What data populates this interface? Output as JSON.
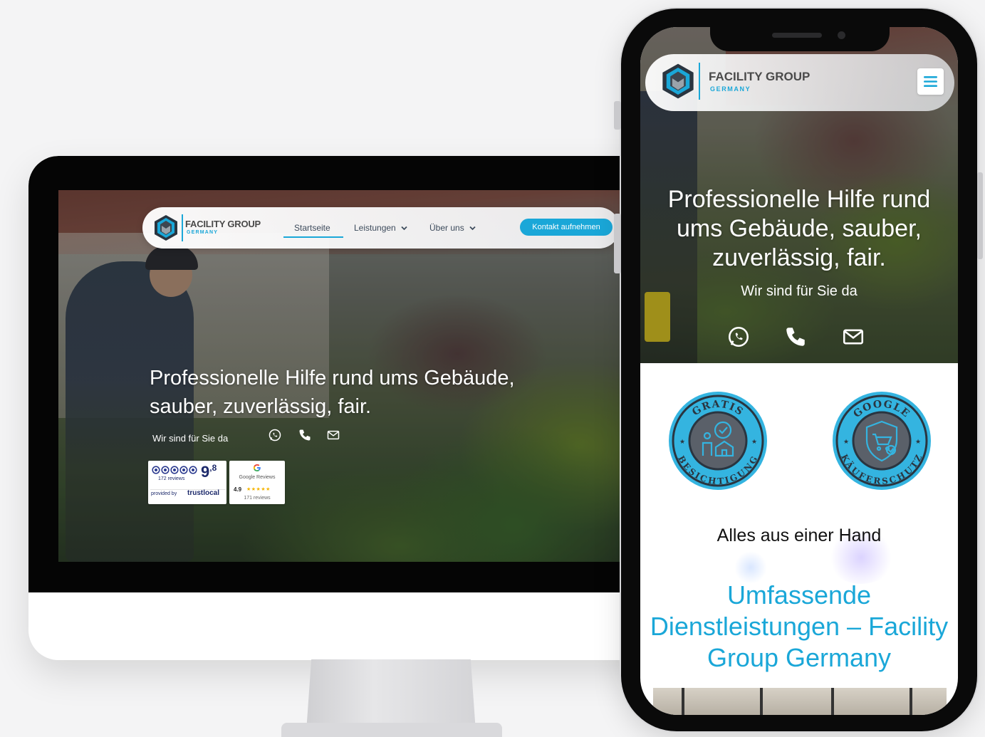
{
  "desktop": {
    "brand": "FACILITY GROUP",
    "brand_sub": "GERMANY",
    "nav": {
      "items": [
        {
          "label": "Startseite",
          "active": true
        },
        {
          "label": "Leistungen",
          "has_dropdown": true
        },
        {
          "label": "Über uns",
          "has_dropdown": true
        }
      ],
      "cta": "Kontakt aufnehmen"
    },
    "hero": {
      "headline_line1": "Professionelle Hilfe rund ums Gebäude,",
      "headline_line2": "sauber, zuverlässig, fair.",
      "subline": "Wir sind für Sie da",
      "contact_icons": [
        "whatsapp-icon",
        "phone-icon",
        "mail-icon"
      ]
    },
    "badges": {
      "trustlocal": {
        "score_main": "9",
        "score_decimal": ",8",
        "reviews": "172 reviews",
        "provided_by": "provided by",
        "brand": "trustlocal"
      },
      "google": {
        "title": "Google Reviews",
        "rating": "4.9",
        "stars": "★★★★★",
        "reviews": "171 reviews"
      }
    }
  },
  "mobile": {
    "brand": "FACILITY GROUP",
    "brand_sub": "GERMANY",
    "hero": {
      "headline": "Professionelle Hilfe rund ums Gebäude, sauber, zuverlässig, fair.",
      "subline": "Wir sind für Sie da",
      "contact_icons": [
        "whatsapp-icon",
        "phone-icon",
        "mail-icon"
      ]
    },
    "stamps": [
      {
        "top": "GRATIS",
        "bottom": "BESICHTIGUNG"
      },
      {
        "top": "GOOGLE",
        "bottom": "KÄUFERSCHUTZ"
      }
    ],
    "section_kicker": "Alles aus einer Hand",
    "section_title": "Umfassende Dienstleistungen – Facility Group Germany"
  },
  "colors": {
    "accent": "#1aa7d8",
    "stamp_ring": "#34b4e0",
    "stamp_inner": "#5a6069",
    "nav_text": "#3d4b5c"
  }
}
